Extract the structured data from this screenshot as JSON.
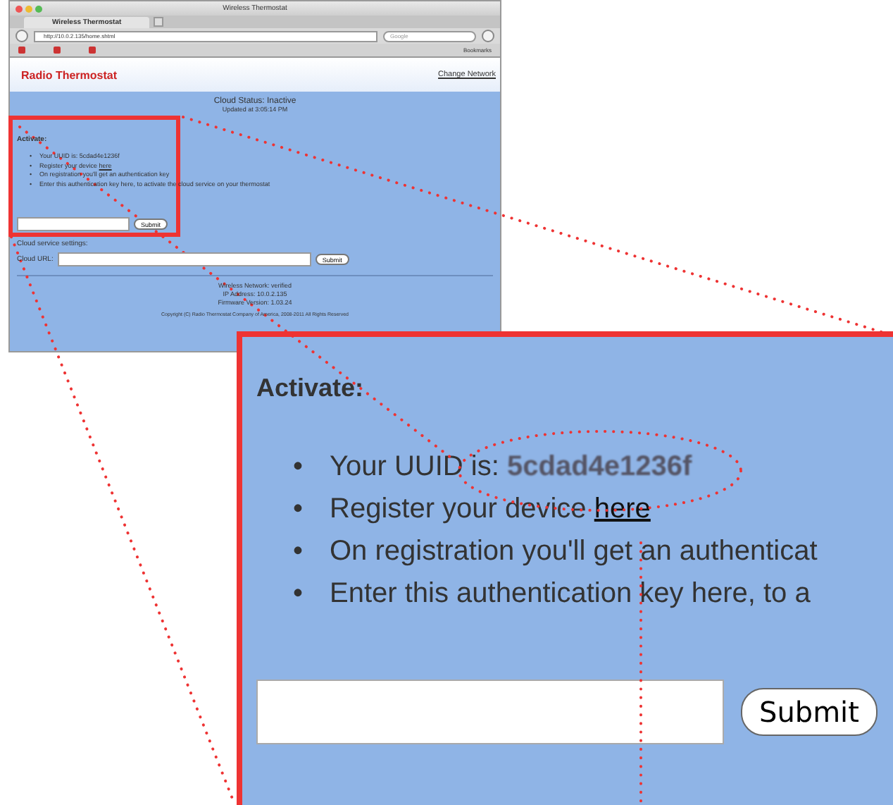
{
  "browser": {
    "title": "Wireless Thermostat",
    "tab": "Wireless Thermostat",
    "url": "http://10.0.2.135/home.shtml",
    "search_placeholder": "Google",
    "bookmarks_label": "Bookmarks"
  },
  "bullet": "•",
  "page": {
    "logo": "Radio Thermostat",
    "change_network": "Change Network",
    "cloud_status": "Cloud Status: Inactive",
    "updated": "Updated at 3:05:14 PM",
    "activate": {
      "heading": "Activate:",
      "uuid_label": "Your UUID is:",
      "uuid": "5cdad4e1236f",
      "register_text": "Register your device",
      "register_link": "here",
      "step_3": "On registration you'll get an authentication key",
      "step_4": "Enter this authentication key here, to activate the cloud service on your thermostat",
      "submit": "Submit"
    },
    "cloud_settings": {
      "heading": "Cloud service settings:",
      "url_label": "Cloud URL:",
      "submit": "Submit"
    },
    "footer": [
      "Wireless Network: verified",
      "IP Address: 10.0.2.135",
      "Firmware Version: 1.03.24"
    ],
    "copyright": "Copyright (C) Radio Thermostat Company of America, 2008-2011 All Rights Reserved"
  },
  "callout": {
    "heading": "Activate:",
    "uuid_label": "Your UUID is:",
    "uuid": "5cdad4e1236f",
    "register_text": "Register your device",
    "register_link": "here",
    "step_3": "On registration you'll get an authenticat",
    "step_4": "Enter this authentication key here, to a",
    "submit": "Submit"
  }
}
